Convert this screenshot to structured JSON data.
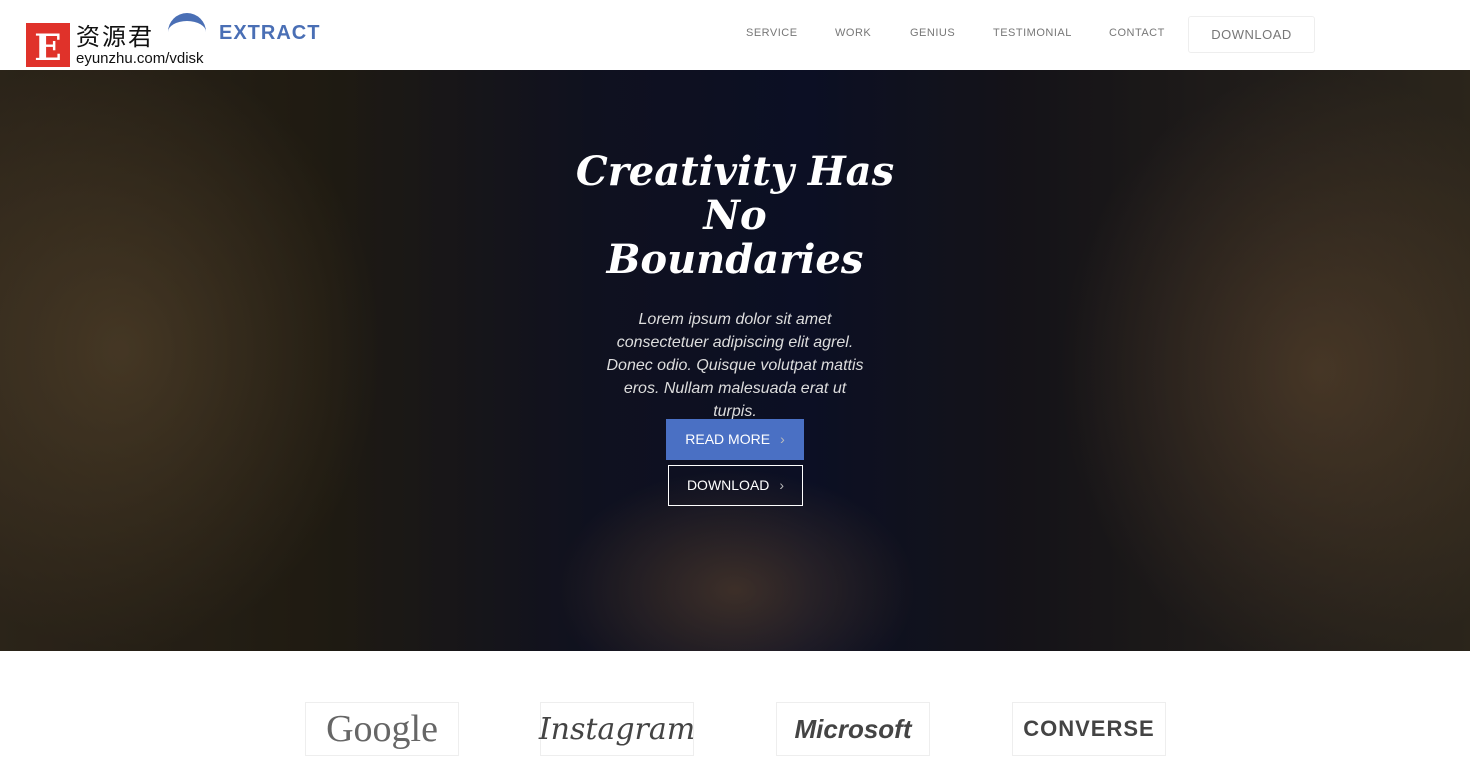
{
  "watermark": {
    "letter": "E",
    "chinese": "资源君",
    "url": "eyunzhu.com/vdisk"
  },
  "header": {
    "brand": "EXTRACT",
    "nav": [
      {
        "label": "SERVICE"
      },
      {
        "label": "WORK"
      },
      {
        "label": "GENIUS"
      },
      {
        "label": "TESTIMONIAL"
      },
      {
        "label": "CONTACT"
      }
    ],
    "download": "DOWNLOAD"
  },
  "hero": {
    "title_line1": "Creativity Has",
    "title_line2": "No",
    "title_line3": "Boundaries",
    "description": "Lorem ipsum dolor sit amet consectetuer adipiscing elit agrel. Donec odio. Quisque volutpat mattis eros. Nullam malesuada erat ut turpis.",
    "read_more": "READ MORE",
    "download": "DOWNLOAD"
  },
  "clients": [
    {
      "name": "Google"
    },
    {
      "name": "Instagram"
    },
    {
      "name": "Microsoft"
    },
    {
      "name": "CONVERSE"
    }
  ],
  "colors": {
    "accent": "#4a70c4",
    "brand": "#4a6fb5"
  }
}
